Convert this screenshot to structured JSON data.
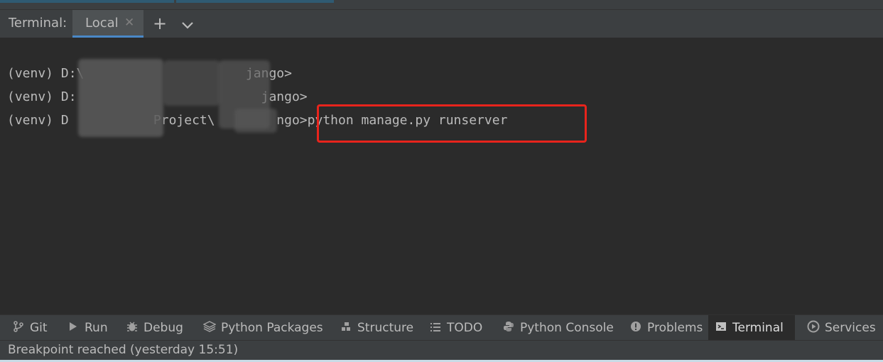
{
  "header": {
    "title": "Terminal:",
    "tab_label": "Local",
    "close_glyph": "✕",
    "add_glyph": "+",
    "menu_glyph": "⌄"
  },
  "terminal": {
    "lines": [
      "(venv) D:\\                     jango>",
      "(venv) D:                        jango>",
      "(venv) D           Project\\        ngo>"
    ],
    "command": "python manage.py runserver"
  },
  "tool_windows": [
    {
      "label": "Git",
      "icon": "git-icon"
    },
    {
      "label": "Run",
      "icon": "run-icon"
    },
    {
      "label": "Debug",
      "icon": "debug-icon"
    },
    {
      "label": "Python Packages",
      "icon": "packages-icon"
    },
    {
      "label": "Structure",
      "icon": "structure-icon"
    },
    {
      "label": "TODO",
      "icon": "todo-icon"
    },
    {
      "label": "Python Console",
      "icon": "python-icon"
    },
    {
      "label": "Problems",
      "icon": "problems-icon"
    },
    {
      "label": "Terminal",
      "icon": "terminal-icon",
      "active": true
    },
    {
      "label": "Services",
      "icon": "services-icon"
    }
  ],
  "status": {
    "message": "Breakpoint reached (yesterday 15:51)"
  },
  "colors": {
    "background": "#2b2b2b",
    "panel": "#3c3f41",
    "accent": "#4a88c7",
    "highlight": "#e8241c"
  }
}
